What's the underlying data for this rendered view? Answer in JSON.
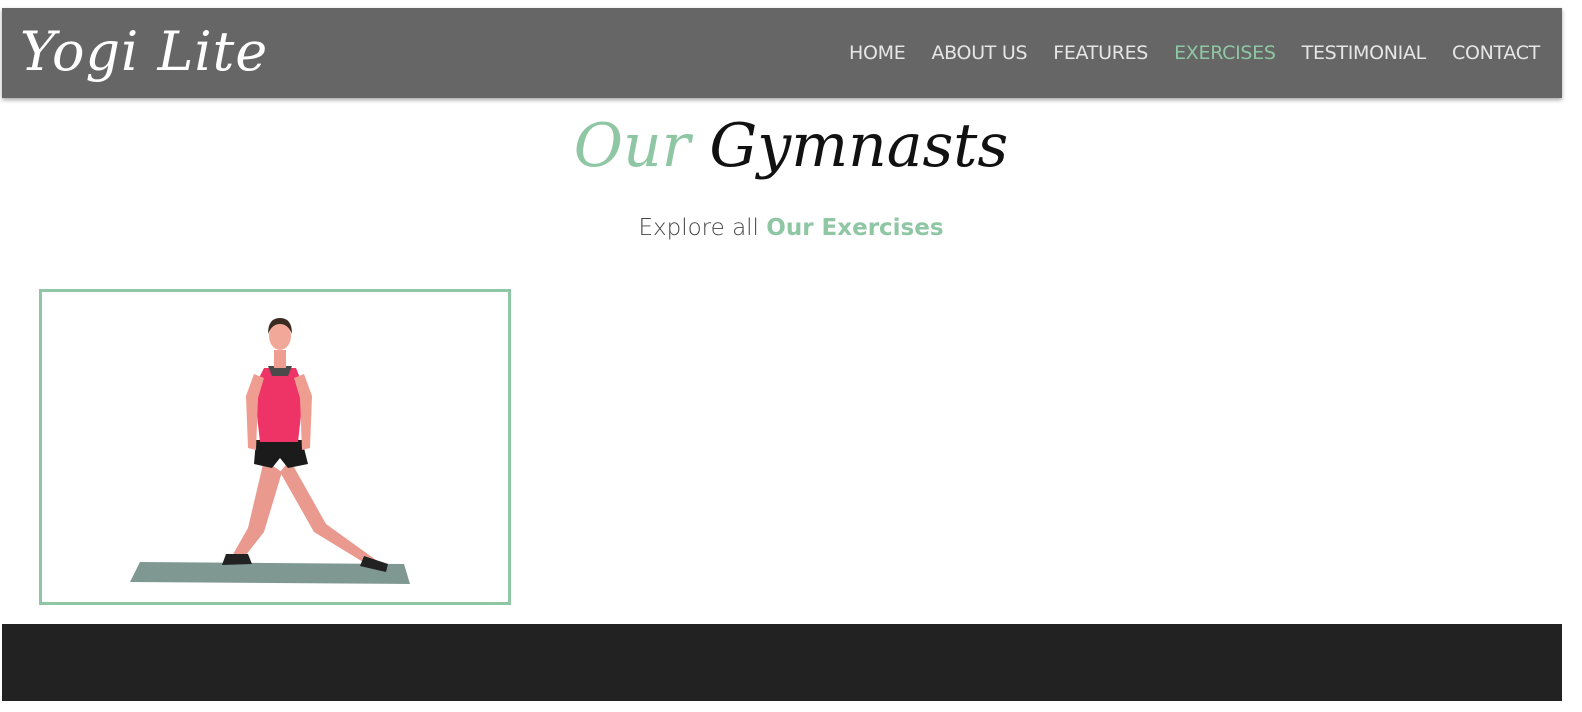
{
  "header": {
    "logo": "Yogi Lite",
    "nav": [
      {
        "label": "HOME",
        "active": false
      },
      {
        "label": "ABOUT US",
        "active": false
      },
      {
        "label": "FEATURES",
        "active": false
      },
      {
        "label": "EXERCISES",
        "active": true
      },
      {
        "label": "TESTIMONIAL",
        "active": false
      },
      {
        "label": "CONTACT",
        "active": false
      }
    ]
  },
  "section": {
    "title_accent": "Our",
    "title_main": "Gymnasts",
    "subtitle_prefix": "Explore all",
    "subtitle_highlight": "Our Exercises"
  },
  "gallery": {
    "items": [
      {
        "icon": "gymnast-photo"
      }
    ]
  },
  "colors": {
    "accent": "#8fc6a3",
    "navbar": "#666666",
    "footer": "#222222",
    "nav_text": "#e6e6e6"
  }
}
